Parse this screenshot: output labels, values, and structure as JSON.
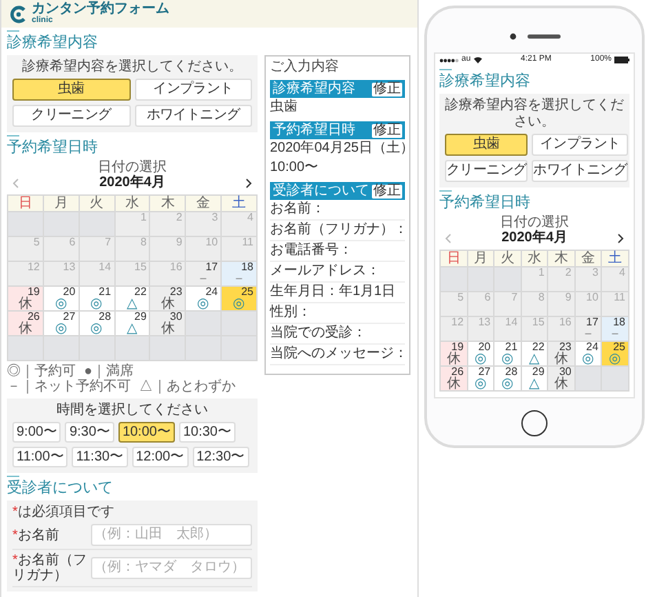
{
  "desktop": {
    "header": {
      "logo_title": "カンタン予約フォーム",
      "logo_subtitle": "clinic"
    },
    "service_section": {
      "title": "診療希望内容",
      "instruction": "診療希望内容を選択してください。",
      "options": [
        {
          "label": "虫歯",
          "selected": true
        },
        {
          "label": "インプラント",
          "selected": false
        },
        {
          "label": "クリーニング",
          "selected": false
        },
        {
          "label": "ホワイトニング",
          "selected": false
        }
      ]
    },
    "date_section": {
      "title": "予約希望日時",
      "date_label": "日付の選択",
      "month": "2020年4月",
      "weekdays": [
        "日",
        "月",
        "火",
        "水",
        "木",
        "金",
        "土"
      ],
      "weeks": [
        [
          {
            "kind": "empty",
            "selected": false
          },
          {
            "kind": "empty",
            "selected": false
          },
          {
            "kind": "empty",
            "selected": false
          },
          {
            "day": "1",
            "kind": "past",
            "selected": false
          },
          {
            "day": "2",
            "kind": "past",
            "selected": false
          },
          {
            "day": "3",
            "kind": "past",
            "selected": false
          },
          {
            "day": "4",
            "kind": "past",
            "selected": false
          }
        ],
        [
          {
            "day": "5",
            "kind": "past",
            "selected": false
          },
          {
            "day": "6",
            "kind": "past",
            "selected": false
          },
          {
            "day": "7",
            "kind": "past",
            "selected": false
          },
          {
            "day": "8",
            "kind": "past",
            "selected": false
          },
          {
            "day": "9",
            "kind": "past",
            "selected": false
          },
          {
            "day": "10",
            "kind": "past",
            "selected": false
          },
          {
            "day": "11",
            "kind": "past",
            "selected": false
          }
        ],
        [
          {
            "day": "12",
            "kind": "past",
            "selected": false
          },
          {
            "day": "13",
            "kind": "past",
            "selected": false
          },
          {
            "day": "14",
            "kind": "past",
            "selected": false
          },
          {
            "day": "15",
            "kind": "past",
            "selected": false
          },
          {
            "day": "16",
            "kind": "past",
            "selected": false
          },
          {
            "day": "17",
            "kind": "unavailable",
            "mark": "－",
            "selected": false
          },
          {
            "day": "18",
            "kind": "unavailable",
            "mark": "－",
            "selected": false
          }
        ],
        [
          {
            "day": "19",
            "kind": "closed",
            "mark": "休",
            "selected": false
          },
          {
            "day": "20",
            "kind": "open",
            "mark": "◎",
            "selected": false
          },
          {
            "day": "21",
            "kind": "open",
            "mark": "◎",
            "selected": false
          },
          {
            "day": "22",
            "kind": "few",
            "mark": "△",
            "selected": false
          },
          {
            "day": "23",
            "kind": "closed",
            "mark": "休",
            "selected": false
          },
          {
            "day": "24",
            "kind": "open",
            "mark": "◎",
            "selected": false
          },
          {
            "day": "25",
            "kind": "open",
            "mark": "◎",
            "selected": true
          }
        ],
        [
          {
            "day": "26",
            "kind": "closed",
            "mark": "休",
            "selected": false
          },
          {
            "day": "27",
            "kind": "open",
            "mark": "◎",
            "selected": false
          },
          {
            "day": "28",
            "kind": "open",
            "mark": "◎",
            "selected": false
          },
          {
            "day": "29",
            "kind": "few",
            "mark": "△",
            "selected": false
          },
          {
            "day": "30",
            "kind": "closed",
            "mark": "休",
            "selected": false
          },
          {
            "kind": "empty",
            "selected": false
          },
          {
            "kind": "empty",
            "selected": false
          }
        ],
        [
          {
            "kind": "empty",
            "selected": false
          },
          {
            "kind": "empty",
            "selected": false
          },
          {
            "kind": "empty",
            "selected": false
          },
          {
            "kind": "empty",
            "selected": false
          },
          {
            "kind": "empty",
            "selected": false
          },
          {
            "kind": "empty",
            "selected": false
          },
          {
            "kind": "empty",
            "selected": false
          }
        ]
      ],
      "legend": [
        "◎｜予約可",
        "●｜満席",
        "－｜ネット予約不可",
        "△｜あとわずか"
      ],
      "time_label": "時間を選択してください",
      "times": [
        {
          "label": "9:00〜",
          "selected": false
        },
        {
          "label": "9:30〜",
          "selected": false
        },
        {
          "label": "10:00〜",
          "selected": true
        },
        {
          "label": "10:30〜",
          "selected": false
        },
        {
          "label": "11:00〜",
          "selected": false
        },
        {
          "label": "11:30〜",
          "selected": false
        },
        {
          "label": "12:00〜",
          "selected": false
        },
        {
          "label": "12:30〜",
          "selected": false
        }
      ]
    },
    "patient_section": {
      "title": "受診者について",
      "required_note": {
        "mark": "*",
        "text": "は必須項目です"
      },
      "fields": [
        {
          "mark": "*",
          "label": "お名前",
          "placeholder": "（例：山田　太郎）"
        },
        {
          "mark": "*",
          "label": "お名前（フリガナ）",
          "placeholder": "（例：ヤマダ　タロウ）"
        }
      ]
    },
    "summary": {
      "title": "ご入力内容",
      "groups": [
        {
          "heading": "診療希望内容",
          "edit": "修正",
          "lines": [
            "虫歯"
          ]
        },
        {
          "heading": "予約希望日時",
          "edit": "修正",
          "lines": [
            "2020年04月25日（土）",
            "10:00〜"
          ]
        },
        {
          "heading": "受診者について",
          "edit": "修正",
          "lines": [
            "お名前：",
            "お名前（フリガナ）：",
            "お電話番号：",
            "メールアドレス：",
            "生年月日：年1月1日",
            "性別：",
            "当院での受診：",
            "当院へのメッセージ："
          ]
        }
      ]
    }
  },
  "phone": {
    "status_bar": {
      "carrier": "au",
      "time": "4:21 PM",
      "battery": "100%"
    },
    "service_section": {
      "title": "診療希望内容",
      "instruction": "診療希望内容を選択してください。",
      "options": [
        {
          "label": "虫歯",
          "selected": true
        },
        {
          "label": "インプラント",
          "selected": false
        },
        {
          "label": "クリーニング",
          "selected": false
        },
        {
          "label": "ホワイトニング",
          "selected": false
        }
      ]
    },
    "date_section": {
      "title": "予約希望日時",
      "date_label": "日付の選択",
      "month": "2020年4月",
      "weekdays": [
        "日",
        "月",
        "火",
        "水",
        "木",
        "金",
        "土"
      ],
      "weeks": [
        [
          {
            "kind": "empty",
            "selected": false
          },
          {
            "kind": "empty",
            "selected": false
          },
          {
            "kind": "empty",
            "selected": false
          },
          {
            "day": "1",
            "kind": "past",
            "selected": false
          },
          {
            "day": "2",
            "kind": "past",
            "selected": false
          },
          {
            "day": "3",
            "kind": "past",
            "selected": false
          },
          {
            "day": "4",
            "kind": "past",
            "selected": false
          }
        ],
        [
          {
            "day": "5",
            "kind": "past",
            "selected": false
          },
          {
            "day": "6",
            "kind": "past",
            "selected": false
          },
          {
            "day": "7",
            "kind": "past",
            "selected": false
          },
          {
            "day": "8",
            "kind": "past",
            "selected": false
          },
          {
            "day": "9",
            "kind": "past",
            "selected": false
          },
          {
            "day": "10",
            "kind": "past",
            "selected": false
          },
          {
            "day": "11",
            "kind": "past",
            "selected": false
          }
        ],
        [
          {
            "day": "12",
            "kind": "past",
            "selected": false
          },
          {
            "day": "13",
            "kind": "past",
            "selected": false
          },
          {
            "day": "14",
            "kind": "past",
            "selected": false
          },
          {
            "day": "15",
            "kind": "past",
            "selected": false
          },
          {
            "day": "16",
            "kind": "past",
            "selected": false
          },
          {
            "day": "17",
            "kind": "unavailable",
            "mark": "－",
            "selected": false
          },
          {
            "day": "18",
            "kind": "unavailable",
            "mark": "－",
            "selected": false
          }
        ],
        [
          {
            "day": "19",
            "kind": "closed",
            "mark": "休",
            "selected": false
          },
          {
            "day": "20",
            "kind": "open",
            "mark": "◎",
            "selected": false
          },
          {
            "day": "21",
            "kind": "open",
            "mark": "◎",
            "selected": false
          },
          {
            "day": "22",
            "kind": "few",
            "mark": "△",
            "selected": false
          },
          {
            "day": "23",
            "kind": "closed",
            "mark": "休",
            "selected": false
          },
          {
            "day": "24",
            "kind": "open",
            "mark": "◎",
            "selected": false
          },
          {
            "day": "25",
            "kind": "open",
            "mark": "◎",
            "selected": true
          }
        ],
        [
          {
            "day": "26",
            "kind": "closed",
            "mark": "休",
            "selected": false
          },
          {
            "day": "27",
            "kind": "open",
            "mark": "◎",
            "selected": false
          },
          {
            "day": "28",
            "kind": "open",
            "mark": "◎",
            "selected": false
          },
          {
            "day": "29",
            "kind": "few",
            "mark": "△",
            "selected": false
          },
          {
            "day": "30",
            "kind": "closed",
            "mark": "休",
            "selected": false
          },
          {
            "kind": "empty",
            "selected": false
          },
          {
            "kind": "empty",
            "selected": false
          }
        ]
      ]
    }
  }
}
